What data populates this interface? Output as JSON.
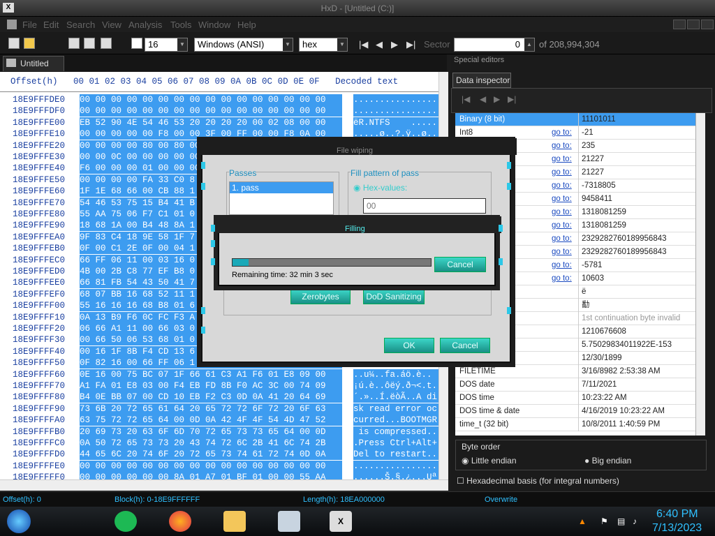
{
  "app": {
    "title": "HxD - [Untitled (C:)]"
  },
  "menu": [
    "File",
    "Edit",
    "Search",
    "View",
    "Analysis",
    "Tools",
    "Window",
    "Help"
  ],
  "toolbar": {
    "bytes_per_row": "16",
    "charset": "Windows (ANSI)",
    "display": "hex",
    "sector_label": "Sector",
    "sector_value": "0",
    "sector_of": "of 208,994,304"
  },
  "tab": {
    "label": "Untitled (C:)"
  },
  "hex": {
    "header": "  Offset(h)   00 01 02 03 04 05 06 07 08 09 0A 0B 0C 0D 0E 0F   Decoded text",
    "rows": [
      {
        "off": "18E9FFFDE0",
        "bytes": "00 00 00 00 00 00 00 00 00 00 00 00 00 00 00 00",
        "dec": "................"
      },
      {
        "off": "18E9FFFDF0",
        "bytes": "00 00 00 00 00 00 00 00 00 00 00 00 00 00 00 00",
        "dec": "................"
      },
      {
        "off": "18E9FFFE00",
        "bytes": "EB 52 90 4E 54 46 53 20 20 20 20 00 02 08 00 00",
        "dec": "ëR.NTFS    ....."
      },
      {
        "off": "18E9FFFE10",
        "bytes": "00 00 00 00 00 F8 00 00 3F 00 FF 00 00 F8 0A 00",
        "dec": ".....ø..?.ÿ..ø.."
      },
      {
        "off": "18E9FFFE20",
        "bytes": "00 00 00 00 80 00 80 00",
        "dec": ""
      },
      {
        "off": "18E9FFFE30",
        "bytes": "00 00 0C 00 00 00 00 00",
        "dec": ""
      },
      {
        "off": "18E9FFFE40",
        "bytes": "F6 00 00 00 01 00 00 00",
        "dec": ""
      },
      {
        "off": "18E9FFFE50",
        "bytes": "00 00 00 00 FA 33 C0 8",
        "dec": ""
      },
      {
        "off": "18E9FFFE60",
        "bytes": "1F 1E 68 66 00 CB 88 1",
        "dec": ""
      },
      {
        "off": "18E9FFFE70",
        "bytes": "54 46 53 75 15 B4 41 B",
        "dec": ""
      },
      {
        "off": "18E9FFFE80",
        "bytes": "55 AA 75 06 F7 C1 01 0",
        "dec": ""
      },
      {
        "off": "18E9FFFE90",
        "bytes": "18 68 1A 00 B4 48 8A 1",
        "dec": ""
      },
      {
        "off": "18E9FFFEA0",
        "bytes": "9F 83 C4 18 9E 58 1F 7",
        "dec": ""
      },
      {
        "off": "18E9FFFEB0",
        "bytes": "0F 00 C1 2E 0F 00 04 1",
        "dec": ""
      },
      {
        "off": "18E9FFFEC0",
        "bytes": "66 FF 06 11 00 03 16 0",
        "dec": ""
      },
      {
        "off": "18E9FFFED0",
        "bytes": "4B 00 2B C8 77 EF B8 0",
        "dec": ""
      },
      {
        "off": "18E9FFFEE0",
        "bytes": "66 81 FB 54 43 50 41 7",
        "dec": ""
      },
      {
        "off": "18E9FFFEF0",
        "bytes": "68 07 BB 16 68 52 11 1",
        "dec": ""
      },
      {
        "off": "18E9FFFF00",
        "bytes": "55 16 16 16 68 B8 01 6",
        "dec": ""
      },
      {
        "off": "18E9FFFF10",
        "bytes": "0A 13 B9 F6 0C FC F3 A",
        "dec": ""
      },
      {
        "off": "18E9FFFF20",
        "bytes": "06 66 A1 11 00 66 03 0",
        "dec": ""
      },
      {
        "off": "18E9FFFF30",
        "bytes": "00 66 50 06 53 68 01 0",
        "dec": ""
      },
      {
        "off": "18E9FFFF40",
        "bytes": "00 16 1F 8B F4 CD 13 6",
        "dec": ""
      },
      {
        "off": "18E9FFFF50",
        "bytes": "0F 82 16 00 66 FF 06 1",
        "dec": ""
      },
      {
        "off": "18E9FFFF60",
        "bytes": "0E 16 00 75 BC 07 1F 66 61 C3 A1 F6 01 E8 09 00",
        "dec": "..u¼..fa.áö.è.."
      },
      {
        "off": "18E9FFFF70",
        "bytes": "A1 FA 01 E8 03 00 F4 EB FD 8B F0 AC 3C 00 74 09",
        "dec": "¡ú.è..ôëý.ð¬<.t."
      },
      {
        "off": "18E9FFFF80",
        "bytes": "B4 0E BB 07 00 CD 10 EB F2 C3 0D 0A 41 20 64 69",
        "dec": "´.»..Í.ëòÃ..A di"
      },
      {
        "off": "18E9FFFF90",
        "bytes": "73 6B 20 72 65 61 64 20 65 72 72 6F 72 20 6F 63",
        "dec": "sk read error oc"
      },
      {
        "off": "18E9FFFFA0",
        "bytes": "63 75 72 72 65 64 00 0D 0A 42 4F 4F 54 4D 47 52",
        "dec": "curred...BOOTMGR"
      },
      {
        "off": "18E9FFFFB0",
        "bytes": "20 69 73 20 63 6F 6D 70 72 65 73 73 65 64 00 0D",
        "dec": " is compressed.."
      },
      {
        "off": "18E9FFFFC0",
        "bytes": "0A 50 72 65 73 73 20 43 74 72 6C 2B 41 6C 74 2B",
        "dec": ".Press Ctrl+Alt+"
      },
      {
        "off": "18E9FFFFD0",
        "bytes": "44 65 6C 20 74 6F 20 72 65 73 74 61 72 74 0D 0A",
        "dec": "Del to restart.."
      },
      {
        "off": "18E9FFFFE0",
        "bytes": "00 00 00 00 00 00 00 00 00 00 00 00 00 00 00 00",
        "dec": "................"
      },
      {
        "off": "18E9FFFFF0",
        "bytes": "00 00 00 00 00 00 8A 01 A7 01 BF 01 00 00 55 AA",
        "dec": "......Š.§.¿...Uª"
      }
    ]
  },
  "special": {
    "title": "Special editors",
    "tab": "Data inspector",
    "rows": [
      {
        "label": "Binary (8 bit)",
        "goto": "",
        "value": "11101011"
      },
      {
        "label": "Int8",
        "goto": "go to:",
        "value": "-21"
      },
      {
        "label": "",
        "goto": "go to:",
        "value": "235"
      },
      {
        "label": "",
        "goto": "go to:",
        "value": "21227"
      },
      {
        "label": "",
        "goto": "go to:",
        "value": "21227"
      },
      {
        "label": "",
        "goto": "go to:",
        "value": "-7318805"
      },
      {
        "label": "",
        "goto": "go to:",
        "value": "9458411"
      },
      {
        "label": "",
        "goto": "go to:",
        "value": "1318081259"
      },
      {
        "label": "",
        "goto": "go to:",
        "value": "1318081259"
      },
      {
        "label": "",
        "goto": "go to:",
        "value": "2329282760189956843"
      },
      {
        "label": "",
        "goto": "go to:",
        "value": "2329282760189956843"
      },
      {
        "label": "",
        "goto": "go to:",
        "value": "-5781"
      },
      {
        "label": "",
        "goto": "go to:",
        "value": "10603"
      },
      {
        "label": "r8_t",
        "goto": "",
        "value": "ë"
      },
      {
        "label": "r16_t",
        "goto": "",
        "value": "勫"
      },
      {
        "label": "nt",
        "goto": "",
        "value": "1st continuation byte invalid"
      },
      {
        "label": "",
        "goto": "",
        "value": "1210676608"
      },
      {
        "label": "",
        "goto": "",
        "value": "5.75029834011922E-153"
      },
      {
        "label": "",
        "goto": "",
        "value": "12/30/1899"
      },
      {
        "label": "FILETIME",
        "goto": "",
        "value": "3/16/8982 2:53:38 AM"
      },
      {
        "label": "DOS date",
        "goto": "",
        "value": "7/11/2021"
      },
      {
        "label": "DOS time",
        "goto": "",
        "value": "10:23:22 AM"
      },
      {
        "label": "DOS time & date",
        "goto": "",
        "value": "4/16/2019 10:23:22 AM"
      },
      {
        "label": "time_t (32 bit)",
        "goto": "",
        "value": "10/8/2011 1:40:59 PM"
      }
    ],
    "byte_order_label": "Byte order",
    "little_endian": "Little endian",
    "big_endian": "Big endian",
    "hex_basis": "Hexadecimal basis (for integral numbers)"
  },
  "wipe_dialog": {
    "title": "File wiping",
    "passes_label": "Passes",
    "pass_item": "1. pass",
    "fill_pattern_label": "Fill pattern of pass",
    "hex_values_label": "Hex-values:",
    "hex_value": "00",
    "zerobytes": "Zerobytes",
    "dod": "DoD Sanitizing",
    "ok": "OK",
    "cancel": "Cancel"
  },
  "progress_dialog": {
    "title": "Filling",
    "remaining": "Remaining time: 32 min 3 sec",
    "cancel": "Cancel",
    "progress": 0.08
  },
  "status": {
    "offset": "Offset(h): 0",
    "block": "Block(h): 0-18E9FFFFFF",
    "length": "Length(h): 18EA000000",
    "mode": "Overwrite"
  },
  "taskbar": {
    "time": "6:40 PM",
    "date": "7/13/2023"
  }
}
